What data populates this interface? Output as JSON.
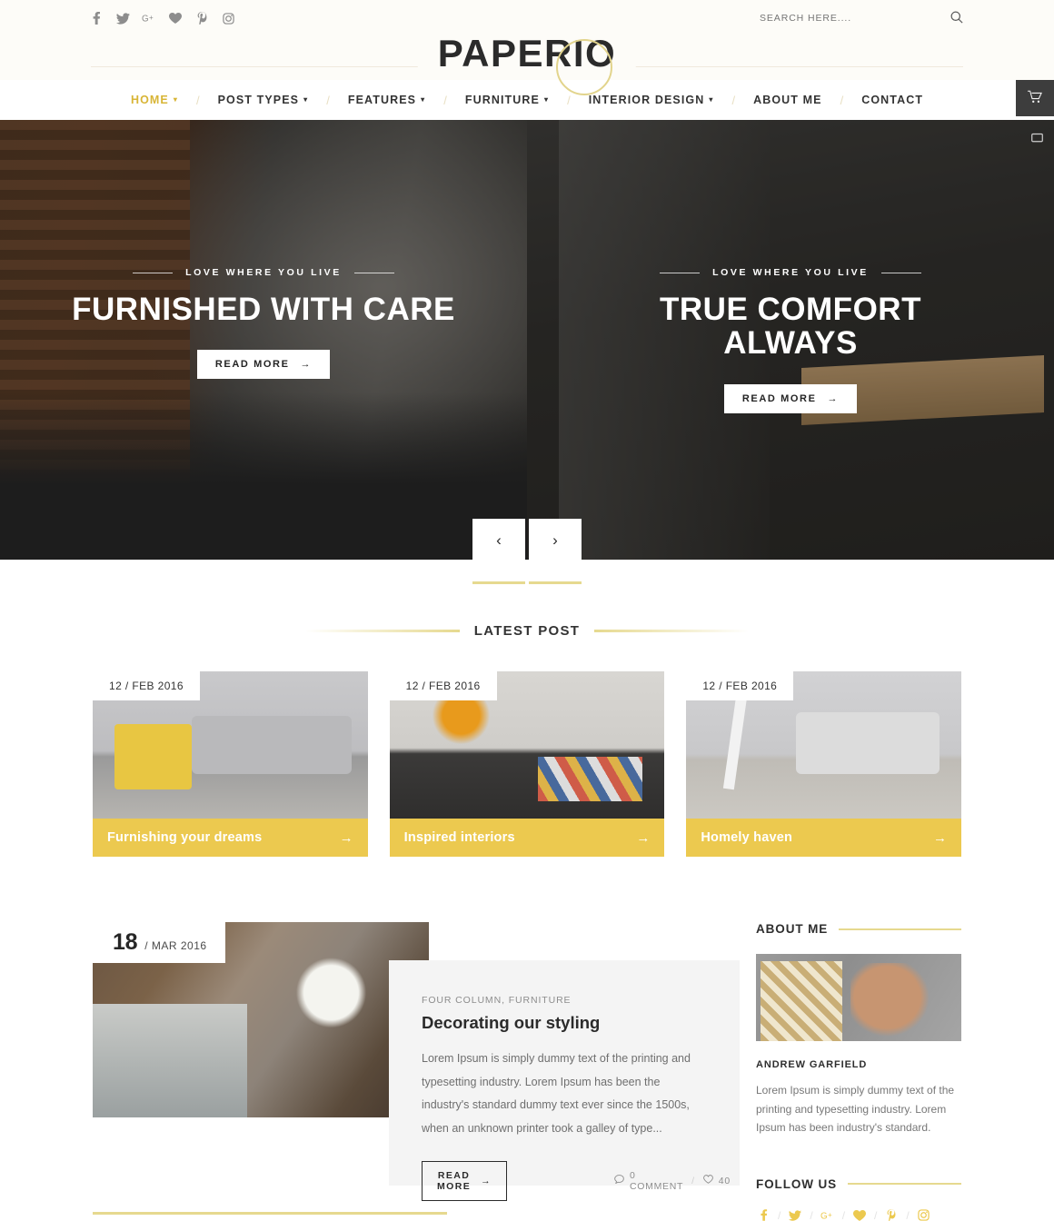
{
  "topbar": {
    "social": [
      {
        "name": "facebook-icon",
        "glyph": "f"
      },
      {
        "name": "twitter-icon",
        "glyph": "🐦"
      },
      {
        "name": "google-plus-icon",
        "glyph": "G+"
      },
      {
        "name": "bloglovin-heart-icon",
        "glyph": "♥"
      },
      {
        "name": "pinterest-icon",
        "glyph": "P"
      },
      {
        "name": "instagram-icon",
        "glyph": "▢"
      }
    ],
    "search_placeholder": "SEARCH HERE....",
    "search_value": ""
  },
  "brand": {
    "logo": "PAPERIO"
  },
  "nav": {
    "items": [
      {
        "label": "HOME",
        "caret": "▾",
        "active": true
      },
      {
        "label": "POST TYPES",
        "caret": "▾",
        "active": false
      },
      {
        "label": "FEATURES",
        "caret": "▾",
        "active": false
      },
      {
        "label": "FURNITURE",
        "caret": "▾",
        "active": false
      },
      {
        "label": "INTERIOR DESIGN",
        "caret": "▾",
        "active": false
      },
      {
        "label": "ABOUT ME",
        "caret": "",
        "active": false
      },
      {
        "label": "CONTACT",
        "caret": "",
        "active": false
      }
    ],
    "separator": "/",
    "cart_label": "cart"
  },
  "hero": {
    "slides": [
      {
        "eyebrow": "LOVE WHERE YOU LIVE",
        "title": "FURNISHED WITH CARE",
        "cta": "READ MORE",
        "cta_arrow": "→"
      },
      {
        "eyebrow": "LOVE WHERE YOU LIVE",
        "title": "TRUE COMFORT ALWAYS",
        "cta": "READ MORE",
        "cta_arrow": "→"
      }
    ],
    "prev_arrow": "‹",
    "next_arrow": "›"
  },
  "latest": {
    "heading": "LATEST POST",
    "cards": [
      {
        "date": "12 / FEB 2016",
        "title": "Furnishing your dreams",
        "arrow": "→"
      },
      {
        "date": "12 / FEB 2016",
        "title": "Inspired interiors",
        "arrow": "→"
      },
      {
        "date": "12 / FEB 2016",
        "title": "Homely haven",
        "arrow": "→"
      }
    ]
  },
  "post": {
    "date_day": "18",
    "date_rest": "/ MAR 2016",
    "categories": "FOUR COLUMN, FURNITURE",
    "title": "Decorating our styling",
    "excerpt": "Lorem Ipsum is simply dummy text of the printing and typesetting industry. Lorem Ipsum has been the industry's standard dummy text ever since the 1500s, when an unknown printer took a galley of type...",
    "cta": "READ MORE",
    "cta_arrow": "→",
    "comments": "0 COMMENT",
    "likes": "40",
    "meta_separator": "/"
  },
  "sidebar": {
    "about_heading": "ABOUT ME",
    "author_name": "ANDREW GARFIELD",
    "about_text": "Lorem Ipsum is simply dummy text of the printing and typesetting industry. Lorem Ipsum has been industry's standard.",
    "follow_heading": "FOLLOW US",
    "follow_separator": "/",
    "follow_social": [
      {
        "name": "facebook-icon",
        "glyph": "f"
      },
      {
        "name": "twitter-icon",
        "glyph": "🐦"
      },
      {
        "name": "google-plus-icon",
        "glyph": "G+"
      },
      {
        "name": "bloglovin-heart-icon",
        "glyph": "♥"
      },
      {
        "name": "pinterest-icon",
        "glyph": "P"
      },
      {
        "name": "instagram-icon",
        "glyph": "▢"
      }
    ]
  },
  "colors": {
    "accent": "#ecc94f",
    "accent_soft": "#e6d98f",
    "nav_active": "#d8b536",
    "dark": "#2b2b2b"
  }
}
